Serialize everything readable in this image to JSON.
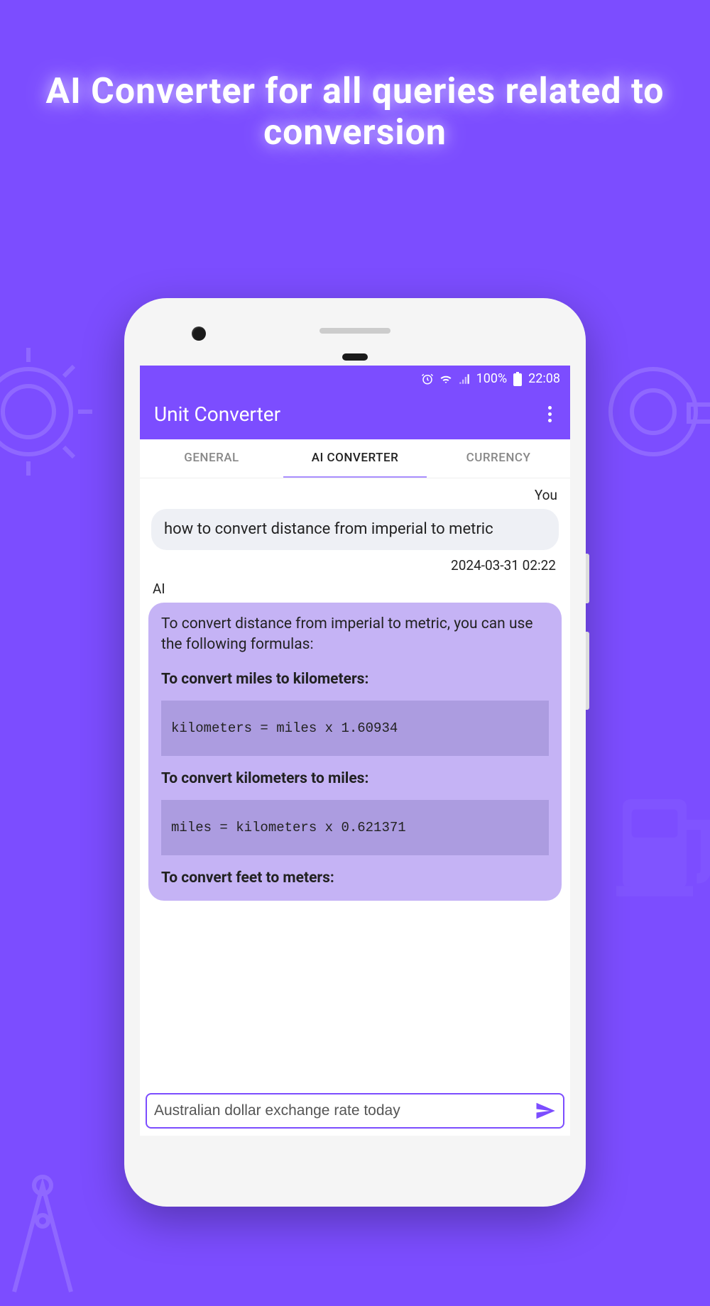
{
  "promo": {
    "title": "AI Converter for all queries related to conversion"
  },
  "status_bar": {
    "battery_pct": "100%",
    "time": "22:08"
  },
  "app_bar": {
    "title": "Unit Converter"
  },
  "tabs": {
    "general": "GENERAL",
    "ai_converter": "AI CONVERTER",
    "currency": "CURRENCY"
  },
  "chat": {
    "user_label": "You",
    "user_message": "how to convert distance from imperial to metric",
    "user_time": "2024-03-31 02:22",
    "ai_label": "AI",
    "ai_intro": "To convert distance from imperial to metric, you can use the following formulas:",
    "section1_title": "To convert miles to kilometers:",
    "section1_code": "kilometers = miles x 1.60934",
    "section2_title": "To convert kilometers to miles:",
    "section2_code": "miles = kilometers x 0.621371",
    "section3_truncated": "To convert feet to meters:"
  },
  "input": {
    "value": "Australian dollar exchange rate today"
  }
}
